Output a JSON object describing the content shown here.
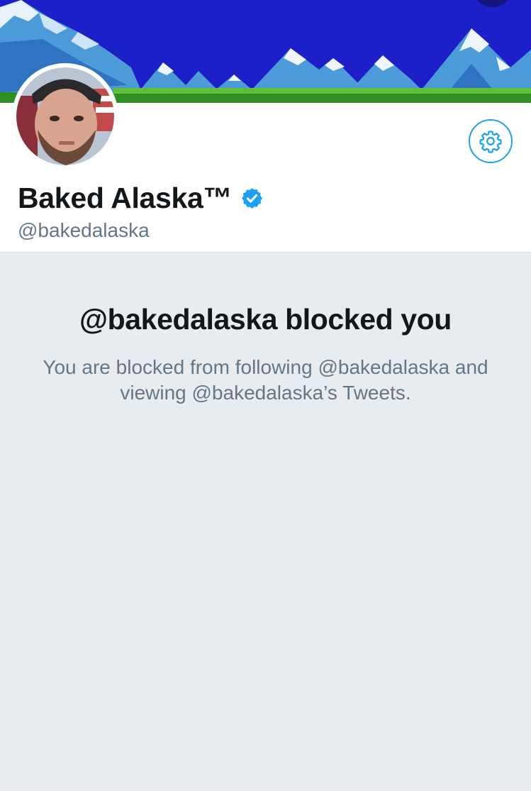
{
  "profile": {
    "display_name": "Baked Alaska™",
    "handle": "@bakedalaska",
    "verified": true
  },
  "blocked_notice": {
    "title": "@bakedalaska blocked you",
    "message": "You are blocked from following @bakedalaska and viewing @bakedalaska’s Tweets."
  },
  "icons": {
    "settings": "gear-icon",
    "verified": "verified-badge-icon"
  },
  "colors": {
    "accent": "#1da1f2",
    "background": "#e6ecf0",
    "primary_text": "#14171a",
    "secondary_text": "#657786",
    "banner_sky": "#1d1fc8"
  }
}
